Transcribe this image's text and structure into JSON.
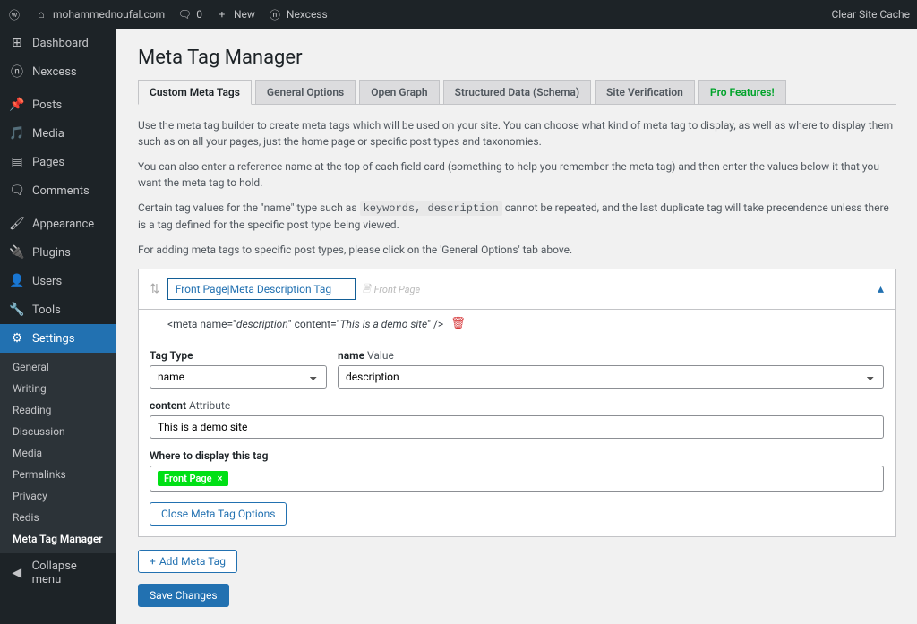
{
  "admin_bar": {
    "site_name": "mohammednoufal.com",
    "comments_count": "0",
    "new_label": "New",
    "nexcess_label": "Nexcess",
    "clear_cache": "Clear Site Cache"
  },
  "sidebar": {
    "items": [
      {
        "label": "Dashboard",
        "icon": "dashboard"
      },
      {
        "label": "Nexcess",
        "icon": "nexcess"
      }
    ],
    "group2": [
      {
        "label": "Posts",
        "icon": "pin"
      },
      {
        "label": "Media",
        "icon": "media"
      },
      {
        "label": "Pages",
        "icon": "pages"
      },
      {
        "label": "Comments",
        "icon": "comments"
      }
    ],
    "group3": [
      {
        "label": "Appearance",
        "icon": "brush"
      },
      {
        "label": "Plugins",
        "icon": "plug"
      },
      {
        "label": "Users",
        "icon": "user"
      },
      {
        "label": "Tools",
        "icon": "wrench"
      },
      {
        "label": "Settings",
        "icon": "gear",
        "current": true
      }
    ],
    "settings_sub": [
      {
        "label": "General"
      },
      {
        "label": "Writing"
      },
      {
        "label": "Reading"
      },
      {
        "label": "Discussion"
      },
      {
        "label": "Media"
      },
      {
        "label": "Permalinks"
      },
      {
        "label": "Privacy"
      },
      {
        "label": "Redis"
      },
      {
        "label": "Meta Tag Manager",
        "current": true
      }
    ],
    "collapse": "Collapse menu"
  },
  "page": {
    "title": "Meta Tag Manager",
    "tabs": [
      {
        "label": "Custom Meta Tags",
        "active": true
      },
      {
        "label": "General Options"
      },
      {
        "label": "Open Graph"
      },
      {
        "label": "Structured Data (Schema)"
      },
      {
        "label": "Site Verification"
      },
      {
        "label": "Pro Features!",
        "pro": true
      }
    ],
    "desc1": "Use the meta tag builder to create meta tags which will be used on your site. You can choose what kind of meta tag to display, as well as where to display them such as on all your pages, just the home page or specific post types and taxonomies.",
    "desc2": "You can also enter a reference name at the top of each field card (something to help you remember the meta tag) and then enter the values below it that you want the meta tag to hold.",
    "desc3_pre": "Certain tag values for the \"name\" type such as ",
    "desc3_code": "keywords, description",
    "desc3_post": " cannot be repeated, and the last duplicate tag will take precendence unless there is a tag defined for the specific post type being viewed.",
    "desc4": "For adding meta tags to specific post types, please click on the 'General Options' tab above."
  },
  "card": {
    "ref_name": "Front Page|Meta Description Tag",
    "hint": "Front Page",
    "preview_prefix": "<meta name=\"",
    "preview_name": "description",
    "preview_mid": "\" content=\"",
    "preview_content": "This is a demo site",
    "preview_suffix": "\" />",
    "labels": {
      "tag_type": "Tag Type",
      "name_value_a": "name",
      "name_value_b": "Value",
      "content_a": "content",
      "content_b": "Attribute",
      "where": "Where to display this tag"
    },
    "tag_type_value": "name",
    "name_value": "description",
    "content_value": "This is a demo site",
    "where_chip": "Front Page",
    "close_btn": "Close Meta Tag Options"
  },
  "buttons": {
    "add_meta": "Add Meta Tag",
    "save": "Save Changes"
  }
}
